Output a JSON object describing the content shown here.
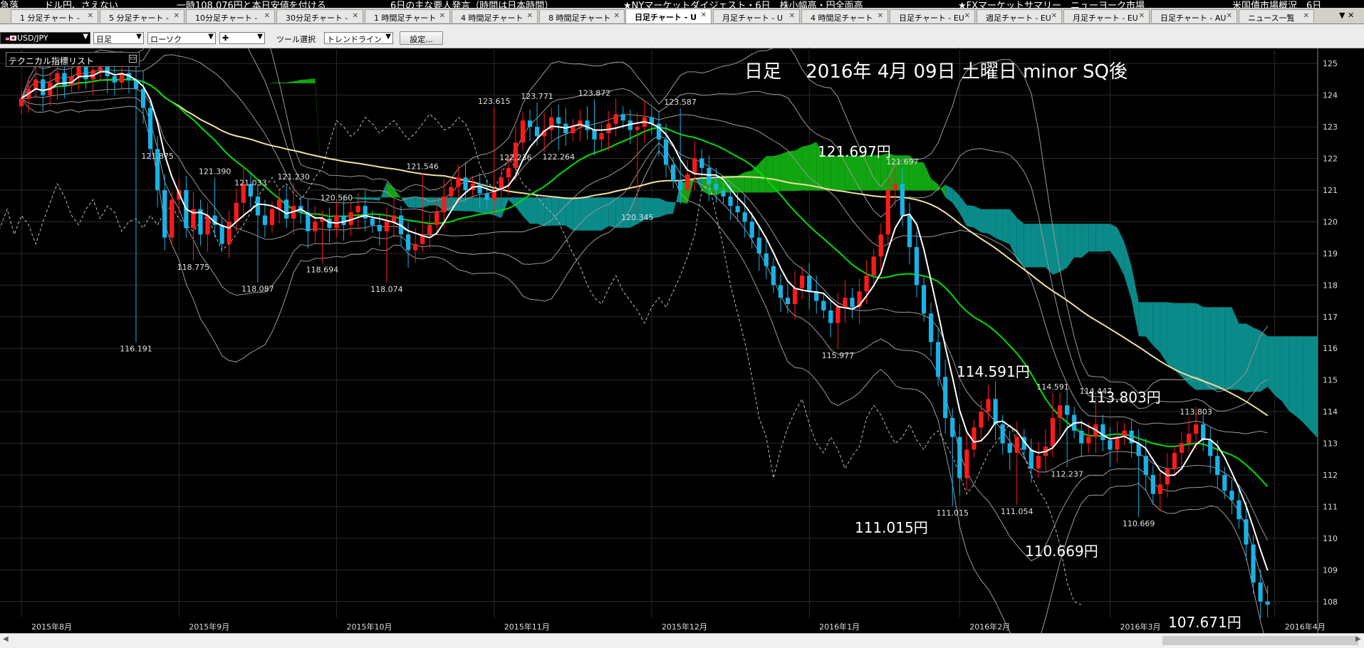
{
  "ticker": [
    "急落",
    "ドル円、さえない",
    "一時108.076円と本日安値を付ける",
    "6日の主な要人発言（時間は日本時間）",
    "★NYマーケットダイジェスト・6日　株小幅高・円全面高",
    "★FXマーケットサマリー　ニューヨーク市場",
    "米国債市場概況　6日"
  ],
  "tabs": [
    {
      "label": "1 分足チャート - "
    },
    {
      "label": "5 分足チャート - "
    },
    {
      "label": "10分足チャート - "
    },
    {
      "label": "30分足チャート - "
    },
    {
      "label": "1 時間足チャート"
    },
    {
      "label": "4 時間足チャート"
    },
    {
      "label": "8 時間足チャート"
    },
    {
      "label": "日足チャート - U",
      "active": true
    },
    {
      "label": "月足チャート - U"
    },
    {
      "label": "4 時間足チャート"
    },
    {
      "label": "日足チャート - EU"
    },
    {
      "label": "週足チャート - EU"
    },
    {
      "label": "月足チャート - EU"
    },
    {
      "label": "日足チャート - AU"
    },
    {
      "label": "ニュース一覧"
    }
  ],
  "tab_close": "✕",
  "tab_menu": "▼ ✕",
  "toolbar": {
    "symbol": "USD/JPY",
    "timeframe": "日足",
    "chart_type": "ローソク",
    "style": "✚",
    "tool_label": "ツール選択",
    "tool": "トレンドライン",
    "settings_label": "設定..."
  },
  "indicator_panel": {
    "title": "テクニカル指標リスト",
    "min": "▭"
  },
  "chart_title": "日足　 2016年 4月 09日 土曜日  minor SQ後",
  "annotations": [
    {
      "text": "121.697円"
    },
    {
      "text": "114.591円"
    },
    {
      "text": "113.803円"
    },
    {
      "text": "111.015円"
    },
    {
      "text": "110.669円"
    },
    {
      "text": "107.671円"
    }
  ],
  "colors": {
    "up_candle": "#ff1a1a",
    "down_candle": "#1ab2e6",
    "kumo_bull": "#11a511",
    "kumo_bear": "#0b8a8a",
    "ma_short": "#ffffff",
    "ma_mid": "#00dd00",
    "ma_long": "#f0e0a0"
  },
  "chart_data": {
    "type": "candlestick",
    "symbol": "USD/JPY",
    "title": "日足　 2016年 4月 09日 土曜日  minor SQ後",
    "ylim": [
      107.5,
      125.5
    ],
    "y_ticks": [
      108,
      109,
      110,
      111,
      112,
      113,
      114,
      115,
      116,
      117,
      118,
      119,
      120,
      121,
      122,
      123,
      124,
      125
    ],
    "x_ticks": [
      {
        "label": "2015年8月",
        "day": 0
      },
      {
        "label": "2015年9月",
        "day": 22
      },
      {
        "label": "2015年10月",
        "day": 44
      },
      {
        "label": "2015年11月",
        "day": 66
      },
      {
        "label": "2015年12月",
        "day": 88
      },
      {
        "label": "2016年1月",
        "day": 110
      },
      {
        "label": "2016年2月",
        "day": 131
      },
      {
        "label": "2016年3月",
        "day": 152
      },
      {
        "label": "2016年4月",
        "day": 175
      }
    ],
    "x_range": [
      -2,
      180
    ],
    "grid": true,
    "closes": [
      123.9,
      124.2,
      124.5,
      124.0,
      124.4,
      124.7,
      124.3,
      124.6,
      124.9,
      124.5,
      124.8,
      124.9,
      124.6,
      124.4,
      124.7,
      124.5,
      124.2,
      123.6,
      122.3,
      121.0,
      119.5,
      120.7,
      121.0,
      119.8,
      120.4,
      119.6,
      120.2,
      119.9,
      119.3,
      120.0,
      120.6,
      121.2,
      120.8,
      120.2,
      119.9,
      120.4,
      120.7,
      120.1,
      120.5,
      120.3,
      119.7,
      120.0,
      120.1,
      119.8,
      120.2,
      119.9,
      120.3,
      120.5,
      120.1,
      119.9,
      119.7,
      120.0,
      120.2,
      119.6,
      119.1,
      119.3,
      119.6,
      119.9,
      120.3,
      120.8,
      121.1,
      121.4,
      121.0,
      121.2,
      120.9,
      120.7,
      121.0,
      121.4,
      121.7,
      122.5,
      123.2,
      123.0,
      122.7,
      122.9,
      123.3,
      123.1,
      122.8,
      123.0,
      123.2,
      122.9,
      122.6,
      122.8,
      123.1,
      123.4,
      123.2,
      122.9,
      123.0,
      123.3,
      123.1,
      122.6,
      121.8,
      121.3,
      121.0,
      121.5,
      122.0,
      121.7,
      121.2,
      121.0,
      120.8,
      120.5,
      120.3,
      120.0,
      119.5,
      119.0,
      118.6,
      118.0,
      117.6,
      117.4,
      117.9,
      118.3,
      117.8,
      117.5,
      117.2,
      116.8,
      117.3,
      117.6,
      117.3,
      117.8,
      118.3,
      118.9,
      119.6,
      121.0,
      121.2,
      120.2,
      119.2,
      118.0,
      117.1,
      116.2,
      115.1,
      113.8,
      113.2,
      111.9,
      112.8,
      113.5,
      114.0,
      114.4,
      113.6,
      113.0,
      112.7,
      113.2,
      112.8,
      112.2,
      112.6,
      112.9,
      113.8,
      114.2,
      113.9,
      113.4,
      113.0,
      113.2,
      113.6,
      113.1,
      112.8,
      113.2,
      113.4,
      113.0,
      112.6,
      112.0,
      111.4,
      111.7,
      112.2,
      112.7,
      113.0,
      113.3,
      113.6,
      113.1,
      112.6,
      112.0,
      111.5,
      111.2,
      110.6,
      109.8,
      108.6,
      108.0,
      107.9
    ],
    "price_labels": [
      {
        "text": "121.875",
        "day": 19,
        "price": 121.875
      },
      {
        "text": "121.390",
        "day": 27,
        "price": 121.39
      },
      {
        "text": "121.033",
        "day": 32,
        "price": 121.033
      },
      {
        "text": "121.230",
        "day": 38,
        "price": 121.23
      },
      {
        "text": "120.560",
        "day": 44,
        "price": 120.56
      },
      {
        "text": "121.546",
        "day": 56,
        "price": 121.546
      },
      {
        "text": "123.615",
        "day": 66,
        "price": 123.615
      },
      {
        "text": "123.771",
        "day": 72,
        "price": 123.771
      },
      {
        "text": "123.872",
        "day": 80,
        "price": 123.872
      },
      {
        "text": "123.587",
        "day": 92,
        "price": 123.587
      },
      {
        "text": "122.236",
        "day": 69,
        "price": 122.236
      },
      {
        "text": "122.264",
        "day": 75,
        "price": 122.264
      },
      {
        "text": "121.697",
        "day": 123,
        "price": 121.697
      },
      {
        "text": "120.345",
        "day": 86,
        "price": 120.345
      },
      {
        "text": "118.775",
        "day": 24,
        "price": 118.775
      },
      {
        "text": "118.087",
        "day": 33,
        "price": 118.087
      },
      {
        "text": "118.694",
        "day": 42,
        "price": 118.694
      },
      {
        "text": "118.074",
        "day": 51,
        "price": 118.074
      },
      {
        "text": "116.191",
        "day": 16,
        "price": 116.191
      },
      {
        "text": "115.977",
        "day": 114,
        "price": 115.977
      },
      {
        "text": "114.591",
        "day": 144,
        "price": 114.591
      },
      {
        "text": "114.447",
        "day": 150,
        "price": 114.447
      },
      {
        "text": "113.803",
        "day": 164,
        "price": 113.803
      },
      {
        "text": "112.237",
        "day": 146,
        "price": 112.237
      },
      {
        "text": "111.015",
        "day": 130,
        "price": 111.015
      },
      {
        "text": "111.054",
        "day": 139,
        "price": 111.054
      },
      {
        "text": "110.669",
        "day": 156,
        "price": 110.669
      }
    ]
  }
}
